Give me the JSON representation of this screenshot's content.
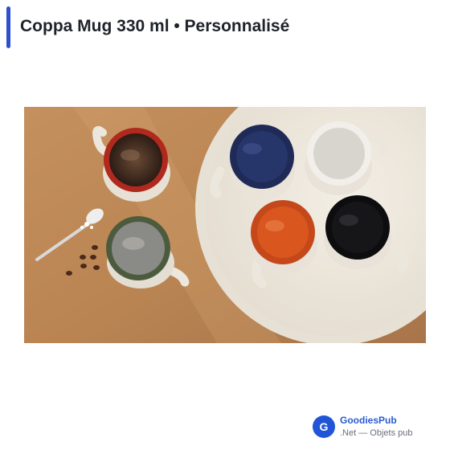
{
  "header": {
    "title": "Coppa Mug 330 ml • Personnalisé"
  },
  "image": {
    "subject": "coffee mugs on a round tray"
  },
  "brand": {
    "logo_letter": "G",
    "name": "GoodiesPub",
    "tagline": ".Net — Objets pub"
  },
  "colors": {
    "accent": "#2f4fce",
    "brand": "#2b5bd0",
    "badge": "#1f55d6"
  }
}
